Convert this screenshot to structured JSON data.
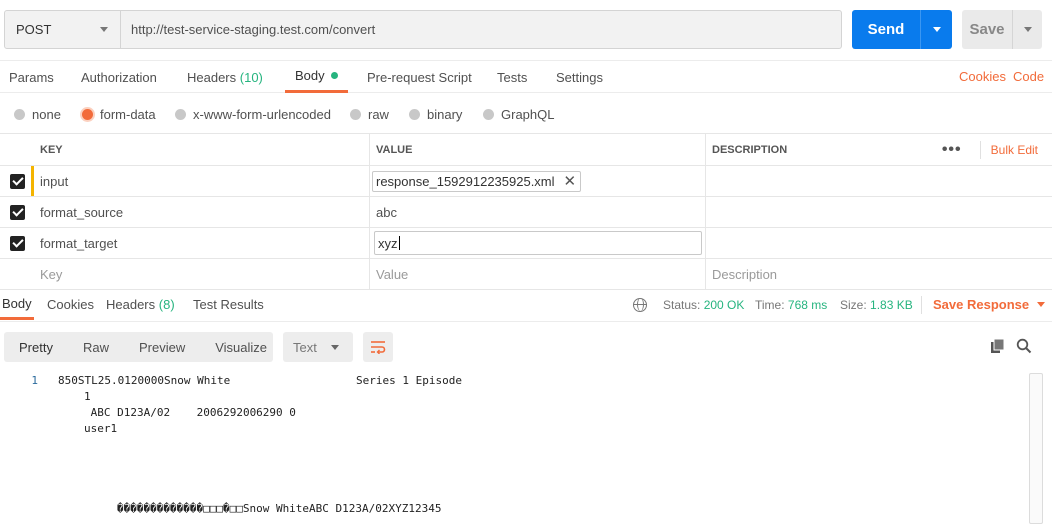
{
  "request": {
    "method": "POST",
    "url": "http://test-service-staging.test.com/convert",
    "send_label": "Send",
    "save_label": "Save"
  },
  "request_tabs": {
    "params": "Params",
    "authorization": "Authorization",
    "headers": "Headers",
    "headers_count": "(10)",
    "body": "Body",
    "prerequest": "Pre-request Script",
    "tests": "Tests",
    "settings": "Settings",
    "cookies": "Cookies",
    "code": "Code"
  },
  "body_types": {
    "none": "none",
    "form_data": "form-data",
    "urlencoded": "x-www-form-urlencoded",
    "raw": "raw",
    "binary": "binary",
    "graphql": "GraphQL",
    "selected": "form-data"
  },
  "params_table": {
    "headers": {
      "key": "KEY",
      "value": "VALUE",
      "description": "DESCRIPTION"
    },
    "bulk_edit": "Bulk Edit",
    "more": "•••",
    "rows": [
      {
        "key": "input",
        "value": "response_1592912235925.xml",
        "checked": true
      },
      {
        "key": "format_source",
        "value": "abc",
        "checked": true
      },
      {
        "key": "format_target",
        "value": "xyz",
        "checked": true
      }
    ],
    "placeholder": {
      "key": "Key",
      "value": "Value",
      "description": "Description"
    }
  },
  "response_tabs": {
    "body": "Body",
    "cookies": "Cookies",
    "headers": "Headers",
    "headers_count": "(8)",
    "test_results": "Test Results"
  },
  "response_meta": {
    "status_label": "Status:",
    "status_value": "200 OK",
    "time_label": "Time:",
    "time_value": "768 ms",
    "size_label": "Size:",
    "size_value": "1.83 KB",
    "save_response": "Save Response"
  },
  "view_modes": {
    "pretty": "Pretty",
    "raw": "Raw",
    "preview": "Preview",
    "visualize": "Visualize",
    "format": "Text"
  },
  "response_body": {
    "line_number": "1",
    "lines": [
      "850STL25.0120000Snow White                   Series 1 Episode",
      "1",
      " ABC D123A/02    2006292006290 0",
      "user1",
      "�������������□□□�□□Snow WhiteABC D123A/02XYZ12345"
    ]
  },
  "colors": {
    "accent": "#f26b3a",
    "send_blue": "#097bed",
    "success_green": "#26b47f"
  },
  "icons": {
    "globe": "globe-icon",
    "wrap": "wrap-lines-icon",
    "copy": "copy-icon",
    "search": "search-icon"
  }
}
